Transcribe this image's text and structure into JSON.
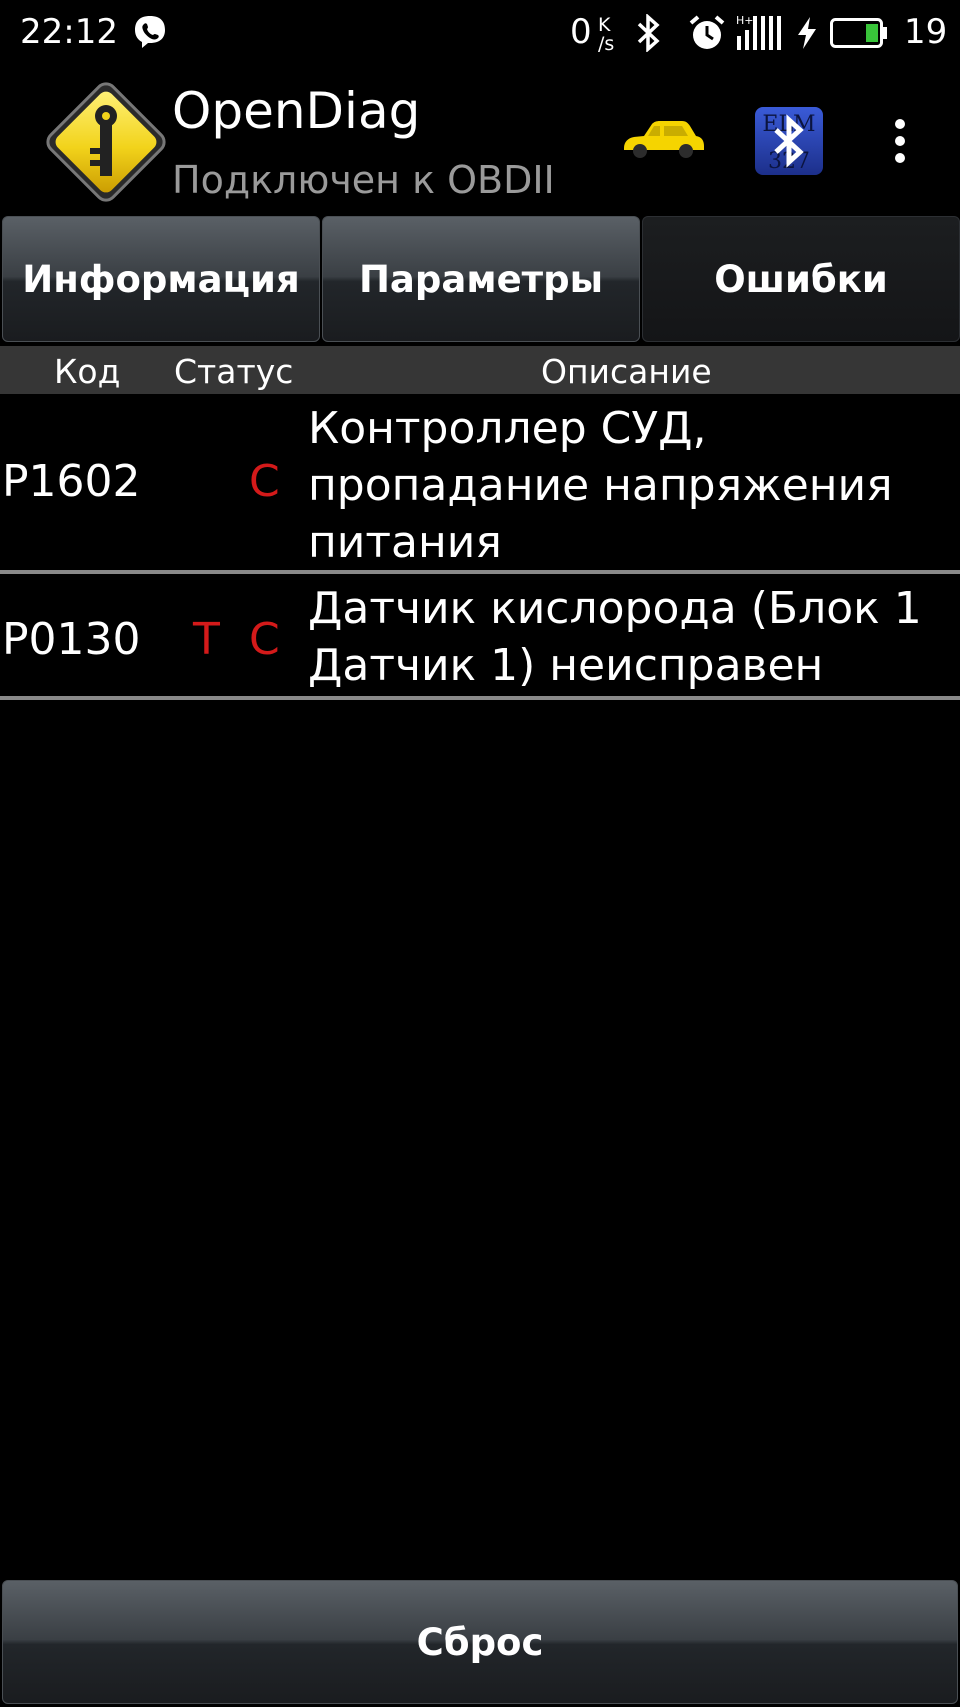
{
  "status_bar": {
    "time": "22:12",
    "speed_value": "0",
    "speed_unit_top": "K",
    "speed_unit_bottom": "/s",
    "battery_level": "19",
    "icons": [
      "viber-icon",
      "bluetooth-icon",
      "alarm-icon",
      "signal-icon",
      "charging-icon",
      "battery-icon"
    ]
  },
  "header": {
    "title": "OpenDiag",
    "subtitle": "Подключен к OBDII",
    "icons": [
      "key-logo-icon",
      "car-icon",
      "elm327-bluetooth-icon",
      "overflow-menu-icon"
    ],
    "elm_label_top": "ELM",
    "elm_label_bottom": "327"
  },
  "tabs": [
    {
      "label": "Информация",
      "active": false
    },
    {
      "label": "Параметры",
      "active": false
    },
    {
      "label": "Ошибки",
      "active": true
    }
  ],
  "table": {
    "columns": [
      "Код",
      "Статус",
      "Описание"
    ],
    "rows": [
      {
        "code": "P1602",
        "flag_t": "",
        "flag_c": "C",
        "description_lines": [
          "Контроллер СУД,",
          "пропадание напряжения",
          "питания"
        ]
      },
      {
        "code": "P0130",
        "flag_t": "T",
        "flag_c": "C",
        "description_lines": [
          "Датчик кислорода (Блок 1",
          "Датчик 1) неисправен"
        ]
      }
    ]
  },
  "reset_button": {
    "label": "Сброс"
  },
  "colors": {
    "background": "#000000",
    "flag_red": "#d41a1a",
    "subtitle_gray": "#9a9a9a",
    "header_row_bg": "#363636",
    "logo_yellow": "#f2d31b",
    "battery_green": "#39c43a"
  }
}
